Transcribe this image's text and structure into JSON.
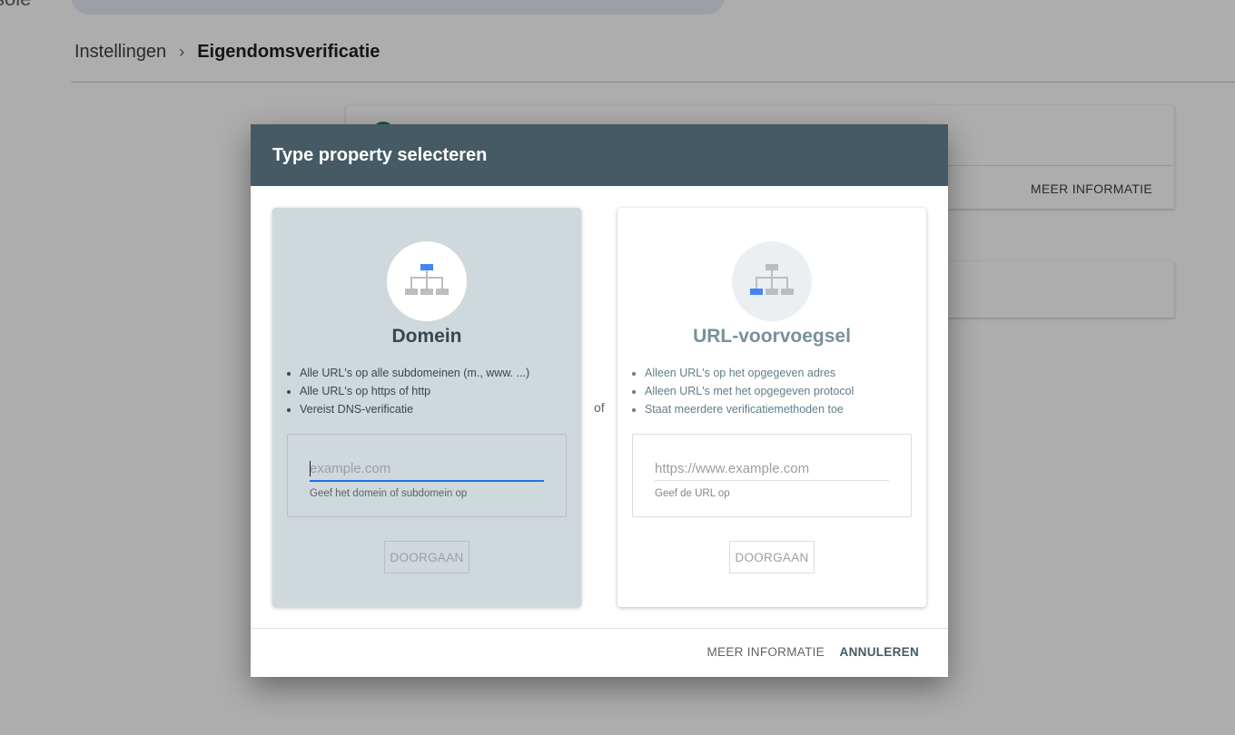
{
  "app": {
    "name_fragment": "sole"
  },
  "breadcrumb": {
    "parent": "Instellingen",
    "separator": "›",
    "current": "Eigendomsverificatie"
  },
  "background_card": {
    "more_info": "MEER INFORMATIE"
  },
  "dialog": {
    "title": "Type property selecteren",
    "separator": "of",
    "domain_option": {
      "title": "Domein",
      "bullets": [
        "Alle URL's op alle subdomeinen (m., www. ...)",
        "Alle URL's op https of http",
        "Vereist DNS-verificatie"
      ],
      "input_placeholder": "example.com",
      "input_value": "",
      "hint": "Geef het domein of subdomein op",
      "continue_label": "DOORGAAN"
    },
    "url_option": {
      "title": "URL-voorvoegsel",
      "bullets": [
        "Alleen URL's op het opgegeven adres",
        "Alleen URL's met het opgegeven protocol",
        "Staat meerdere verificatiemethoden toe"
      ],
      "input_placeholder": "https://www.example.com",
      "input_value": "",
      "hint": "Geef de URL op",
      "continue_label": "DOORGAAN"
    },
    "footer": {
      "more_info": "MEER INFORMATIE",
      "cancel": "ANNULEREN"
    }
  },
  "icons": {
    "domain_option": "sitemap-icon",
    "url_option": "sitemap-icon"
  },
  "colors": {
    "header": "#455a64",
    "selected_option": "#cfd8dc",
    "accent": "#1a73e8",
    "icon_highlight": "#4285f4",
    "icon_grey": "#bdbdbd"
  }
}
